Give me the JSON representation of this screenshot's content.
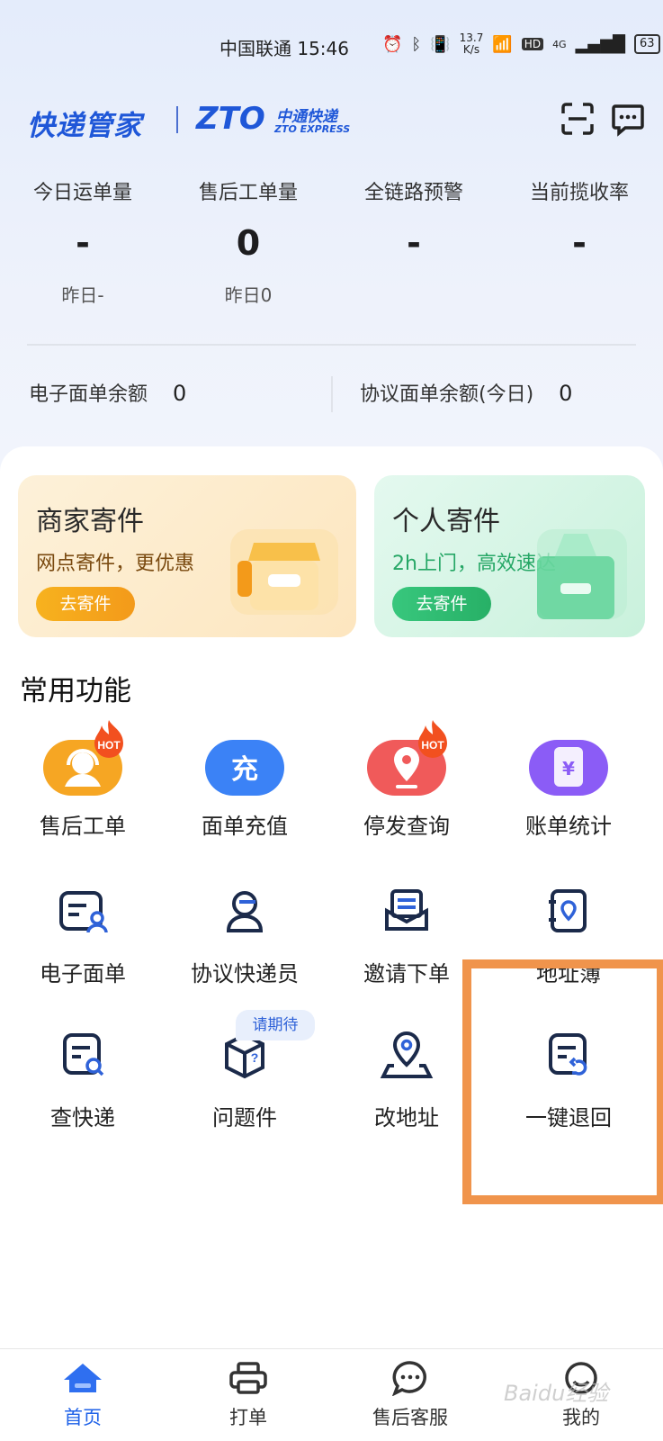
{
  "status_bar": {
    "carrier_time": "中国联通 15:46",
    "speed_top": "13.7",
    "speed_bottom": "K/s",
    "network": "HD",
    "signal": "4G",
    "battery": "63"
  },
  "header": {
    "logo_text": "快递管家",
    "brand_logo": "ZTO",
    "brand_cn": "中通快递",
    "brand_en": "ZTO EXPRESS",
    "scan_icon": "scan-icon",
    "message_icon": "message-icon"
  },
  "stats": [
    {
      "label": "今日运单量",
      "value": "-",
      "sub": "昨日-"
    },
    {
      "label": "售后工单量",
      "value": "0",
      "sub": "昨日0"
    },
    {
      "label": "全链路预警",
      "value": "-",
      "sub": ""
    },
    {
      "label": "当前揽收率",
      "value": "-",
      "sub": ""
    }
  ],
  "balances": [
    {
      "label": "电子面单余额",
      "value": "0"
    },
    {
      "label": "协议面单余额(今日)",
      "value": "0"
    }
  ],
  "cards": [
    {
      "title": "商家寄件",
      "desc": "网点寄件，更优惠",
      "button": "去寄件"
    },
    {
      "title": "个人寄件",
      "desc": "2h上门，高效速达",
      "button": "去寄件"
    }
  ],
  "section_title": "常用功能",
  "features": [
    {
      "label": "售后工单",
      "icon": "headset-icon",
      "badge": "HOT"
    },
    {
      "label": "面单充值",
      "icon": "recharge-icon",
      "glyph": "充"
    },
    {
      "label": "停发查询",
      "icon": "location-pin-icon",
      "badge": "HOT"
    },
    {
      "label": "账单统计",
      "icon": "bill-icon",
      "glyph": "¥"
    },
    {
      "label": "电子面单",
      "icon": "e-waybill-icon"
    },
    {
      "label": "协议快递员",
      "icon": "courier-icon"
    },
    {
      "label": "邀请下单",
      "icon": "invite-icon"
    },
    {
      "label": "地址簿",
      "icon": "address-book-icon"
    },
    {
      "label": "查快递",
      "icon": "search-parcel-icon"
    },
    {
      "label": "问题件",
      "icon": "problem-parcel-icon",
      "badge": "请期待"
    },
    {
      "label": "改地址",
      "icon": "change-address-icon"
    },
    {
      "label": "一键退回",
      "icon": "return-icon"
    }
  ],
  "nav": [
    {
      "label": "首页",
      "icon": "home-icon",
      "active": true
    },
    {
      "label": "打单",
      "icon": "printer-icon"
    },
    {
      "label": "售后客服",
      "icon": "chat-icon"
    },
    {
      "label": "我的",
      "icon": "profile-icon"
    }
  ],
  "watermark": "Baidu经验"
}
